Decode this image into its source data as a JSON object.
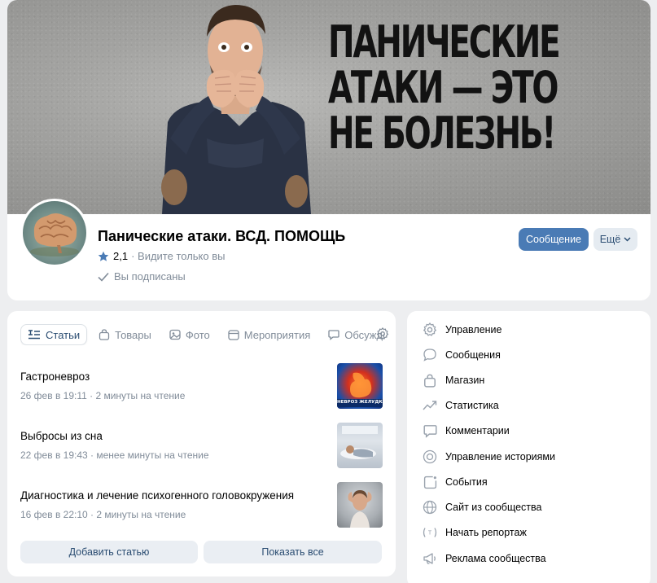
{
  "cover": {
    "headline_lines": [
      "ПАНИЧЕСКИЕ",
      "АТАКИ — ЭТО",
      "НЕ БОЛЕЗНЬ!"
    ]
  },
  "group": {
    "title": "Панические атаки. ВСД. ПОМОЩЬ",
    "rating": "2,1",
    "visibility_note": "· Видите только вы",
    "subscribed": "Вы подписаны",
    "message_button": "Сообщение",
    "more_button": "Ещё"
  },
  "tabs": [
    {
      "label": "Статьи",
      "icon": "articles-icon",
      "active": true
    },
    {
      "label": "Товары",
      "icon": "bag-icon",
      "active": false
    },
    {
      "label": "Фото",
      "icon": "photo-icon",
      "active": false
    },
    {
      "label": "Мероприятия",
      "icon": "calendar-icon",
      "active": false
    },
    {
      "label": "Обсуждения",
      "icon": "discussion-icon",
      "active": false
    }
  ],
  "articles": [
    {
      "title": "Гастроневроз",
      "meta": "26 фев в 19:11 · 2 минуты на чтение",
      "thumb_caption": "НЕВРОЗ ЖЕЛУДКА"
    },
    {
      "title": "Выбросы из сна",
      "meta": "22 фев в 19:43 · менее минуты на чтение"
    },
    {
      "title": "Диагностика и лечение психогенного головокружения",
      "meta": "16 фев в 22:10 · 2 минуты на чтение"
    }
  ],
  "actions": {
    "add_article": "Добавить статью",
    "show_all": "Показать все"
  },
  "menu": [
    {
      "label": "Управление",
      "icon": "gear-icon"
    },
    {
      "label": "Сообщения",
      "icon": "message-icon"
    },
    {
      "label": "Магазин",
      "icon": "bag-icon"
    },
    {
      "label": "Статистика",
      "icon": "chart-icon"
    },
    {
      "label": "Комментарии",
      "icon": "comment-icon"
    },
    {
      "label": "Управление историями",
      "icon": "stories-icon"
    },
    {
      "label": "События",
      "icon": "event-icon"
    },
    {
      "label": "Сайт из сообщества",
      "icon": "globe-icon"
    },
    {
      "label": "Начать репортаж",
      "icon": "broadcast-icon"
    },
    {
      "label": "Реклама сообщества",
      "icon": "megaphone-icon"
    }
  ],
  "colors": {
    "accent": "#4a7bb5",
    "secondary_button_bg": "#e5ebf1",
    "muted_text": "#818c99",
    "page_bg": "#edeef0"
  }
}
